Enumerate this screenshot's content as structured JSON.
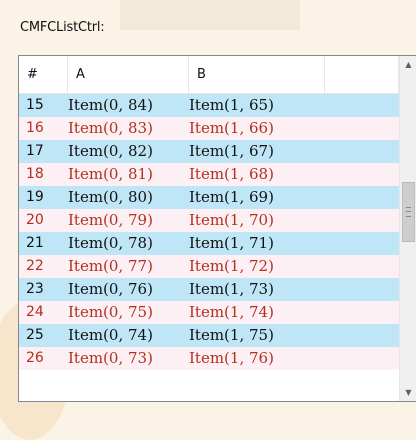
{
  "caption": "CMFCListCtrl:",
  "columns": [
    "#",
    "A",
    "B",
    ""
  ],
  "rows": [
    {
      "num": "15",
      "a": "Item(0, 84)",
      "b": "Item(1, 65)"
    },
    {
      "num": "16",
      "a": "Item(0, 83)",
      "b": "Item(1, 66)"
    },
    {
      "num": "17",
      "a": "Item(0, 82)",
      "b": "Item(1, 67)"
    },
    {
      "num": "18",
      "a": "Item(0, 81)",
      "b": "Item(1, 68)"
    },
    {
      "num": "19",
      "a": "Item(0, 80)",
      "b": "Item(1, 69)"
    },
    {
      "num": "20",
      "a": "Item(0, 79)",
      "b": "Item(1, 70)"
    },
    {
      "num": "21",
      "a": "Item(0, 78)",
      "b": "Item(1, 71)"
    },
    {
      "num": "22",
      "a": "Item(0, 77)",
      "b": "Item(1, 72)"
    },
    {
      "num": "23",
      "a": "Item(0, 76)",
      "b": "Item(1, 73)"
    },
    {
      "num": "24",
      "a": "Item(0, 75)",
      "b": "Item(1, 74)"
    },
    {
      "num": "25",
      "a": "Item(0, 74)",
      "b": "Item(1, 75)"
    },
    {
      "num": "26",
      "a": "Item(0, 73)",
      "b": "Item(1, 76)"
    }
  ],
  "colors": {
    "even_row_bg": "#bfe6f7",
    "odd_row_bg": "#fdf0f4",
    "odd_row_text": "#b3301c"
  },
  "scrollbar": {
    "up_icon": "arrow-up-icon",
    "down_icon": "arrow-down-icon"
  }
}
